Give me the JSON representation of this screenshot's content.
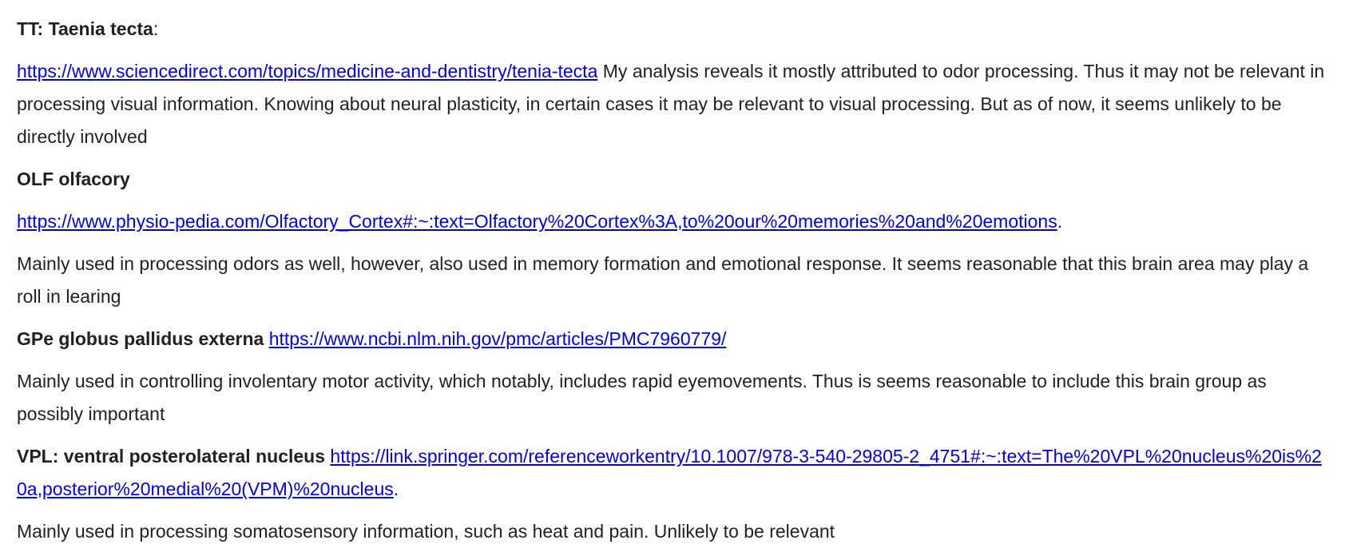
{
  "doc": {
    "tt": {
      "heading": "TT: Taenia tecta",
      "heading_suffix": ":",
      "link": "https://www.sciencedirect.com/topics/medicine-and-dentistry/tenia-tecta",
      "text": " My analysis reveals it mostly attributed to odor processing. Thus it may not be relevant in processing visual information. Knowing about neural plasticity, in certain cases it may be relevant to visual processing. But as of now, it seems unlikely to be directly involved"
    },
    "olf": {
      "heading": "OLF olfacory",
      "link": "https://www.physio-pedia.com/Olfactory_Cortex#:~:text=Olfactory%20Cortex%3A,to%20our%20memories%20and%20emotions",
      "link_suffix": ".",
      "text": "Mainly used in processing odors as well, however, also used in memory formation and emotional response. It seems reasonable that this brain area may play a roll in learing"
    },
    "gpe": {
      "heading": "GPe globus pallidus externa",
      "link": "https://www.ncbi.nlm.nih.gov/pmc/articles/PMC7960779/",
      "text": "Mainly used in controlling involentary motor activity, which notably, includes rapid eyemovements. Thus is seems reasonable to include this brain group as possibly important"
    },
    "vpl": {
      "heading": "VPL: ventral posterolateral nucleus",
      "link": "https://link.springer.com/referenceworkentry/10.1007/978-3-540-29805-2_4751#:~:text=The%20VPL%20nucleus%20is%20a,posterior%20medial%20(VPM)%20nucleus",
      "link_suffix": ".",
      "text": "Mainly used in processing somatosensory information, such as heat and pain. Unlikely to be relevant"
    }
  }
}
